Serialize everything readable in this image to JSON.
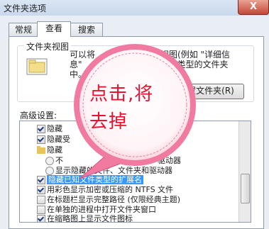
{
  "window": {
    "title": "文件夹选项",
    "close_label": "X"
  },
  "tabs": [
    "常规",
    "查看",
    "搜索"
  ],
  "folder_view": {
    "group_label": "文件夹视图",
    "description": "可以将 .......... 的视图(例如\"详细信息\"...... 这种类型的文件夹中",
    "desc_line1": "可以将",
    "desc_line1b": "的视图(例如 \"详细信",
    "desc_line2": "息\"",
    "desc_line2b": "这种类型的文件夹",
    "desc_line3": "中。",
    "apply_button": "重置文件夹(R)"
  },
  "advanced": {
    "label": "高级设置:",
    "items": [
      {
        "text": "隐藏",
        "type": "checkbox",
        "checked": true
      },
      {
        "text": "隐藏受",
        "type": "checkbox",
        "checked": true
      },
      {
        "text": "隐藏",
        "type": "folder"
      },
      {
        "text": "不",
        "suffix": "驱动器",
        "type": "radio"
      },
      {
        "text": "显示隐藏的文件、文件夹和驱动器",
        "type": "radio"
      },
      {
        "text": "隐藏已知文件类型的扩展名",
        "type": "checkbox",
        "checked": true,
        "selected": true
      },
      {
        "text": "用彩色显示加密或压缩的 NTFS 文件",
        "type": "checkbox",
        "checked": true
      },
      {
        "text": "在标题栏显示完整路径 (仅限经典主题)",
        "type": "checkbox",
        "checked": false
      },
      {
        "text": "在单独的进程中打开文件夹窗口",
        "type": "checkbox",
        "checked": false
      },
      {
        "text": "在缩略图上显示文件图标",
        "type": "checkbox",
        "checked": true
      }
    ]
  },
  "callout": {
    "line1": "点击,将",
    "line2": "去掉",
    "color": "#e8132f"
  }
}
